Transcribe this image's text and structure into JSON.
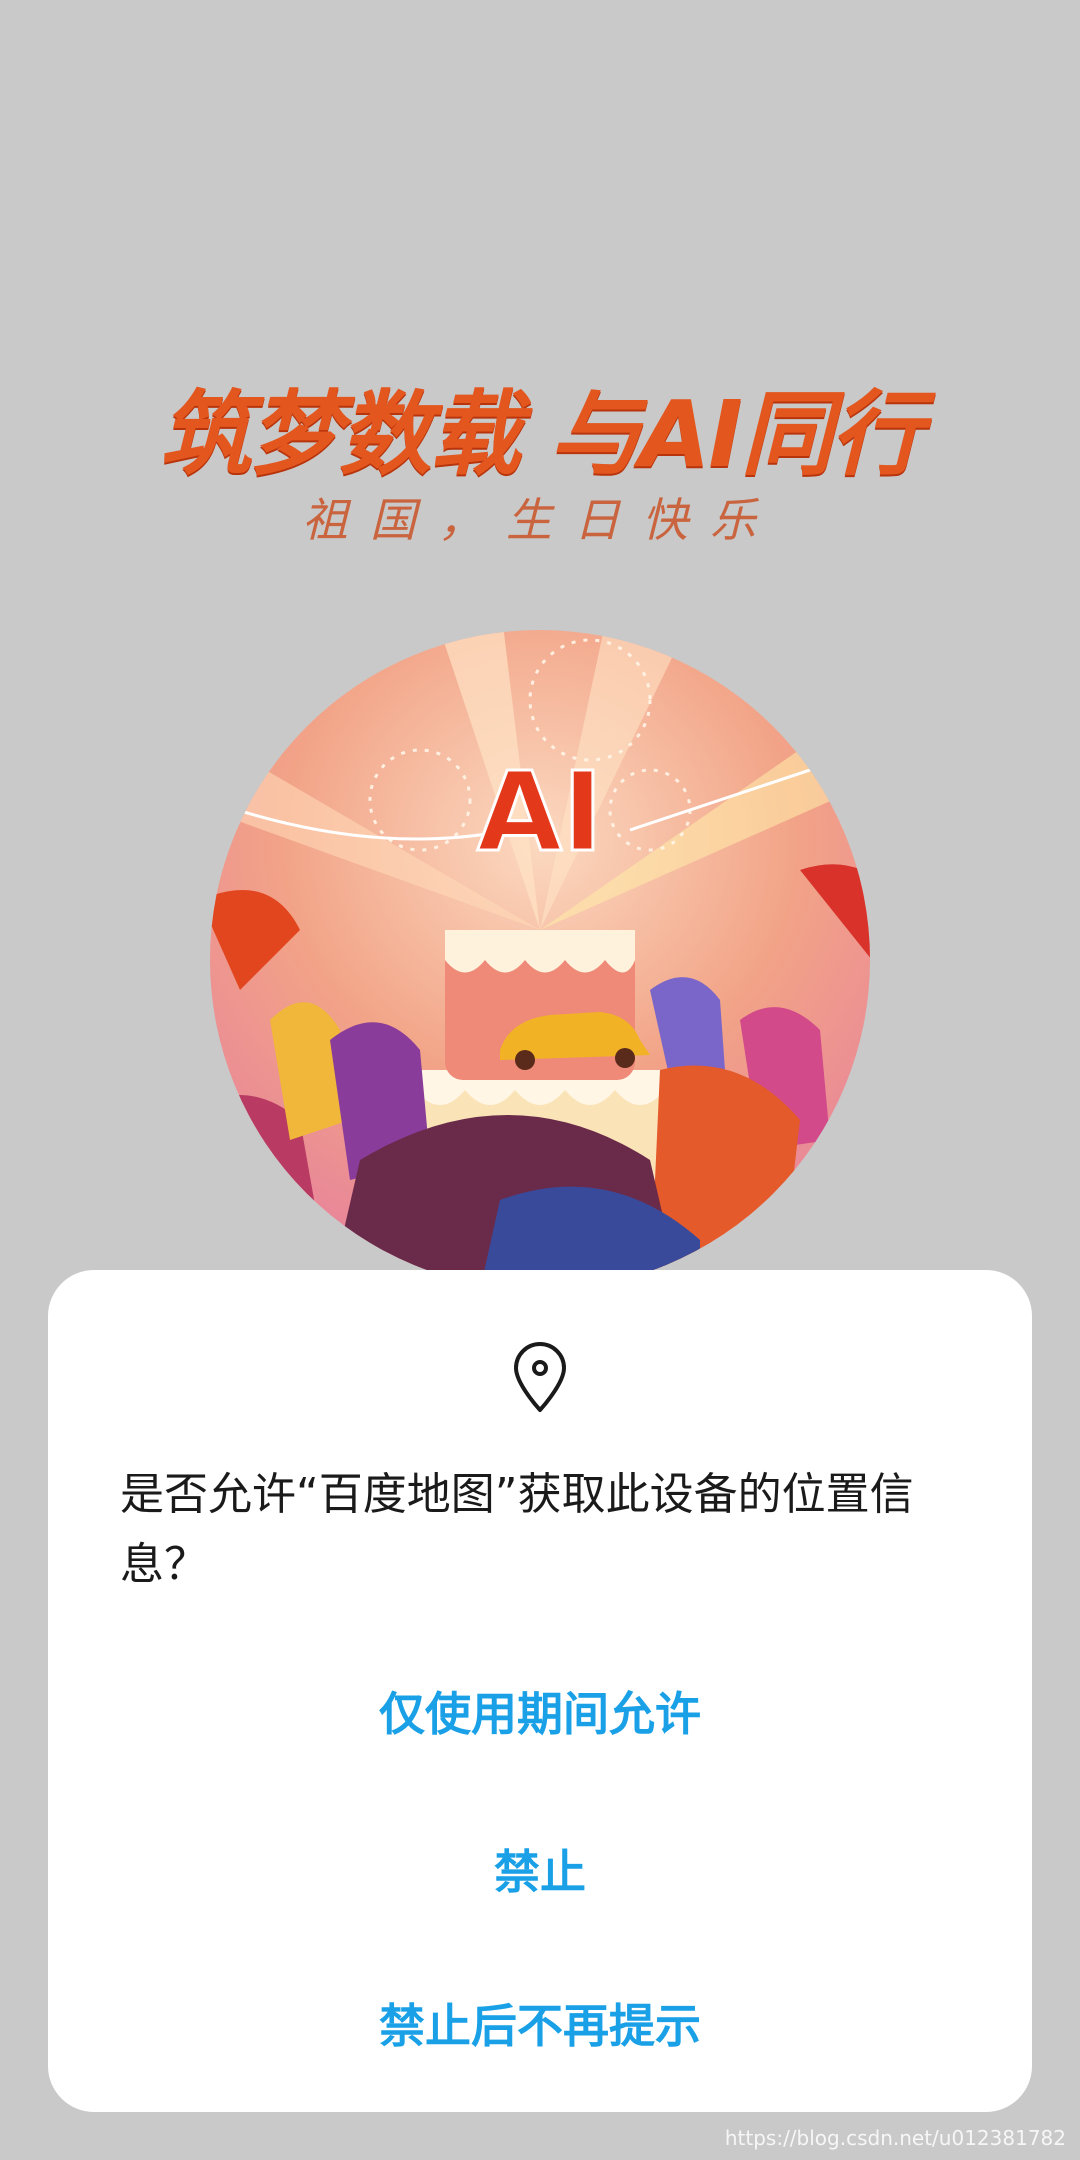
{
  "splash": {
    "headline": "筑梦数载 与AI同行",
    "subline": "祖国，生日快乐",
    "cake_text": "AI"
  },
  "dialog": {
    "icon": "location-pin-icon",
    "message": "是否允许“百度地图”获取此设备的位置信息？",
    "buttons": {
      "allow_while_using": "仅使用期间允许",
      "deny": "禁止",
      "deny_dont_ask": "禁止后不再提示"
    }
  },
  "watermark": "https://blog.csdn.net/u012381782",
  "colors": {
    "backdrop": "#c9c9c9",
    "headline": "#e3571f",
    "button": "#1aa0e6",
    "dialog_bg": "#ffffff"
  }
}
